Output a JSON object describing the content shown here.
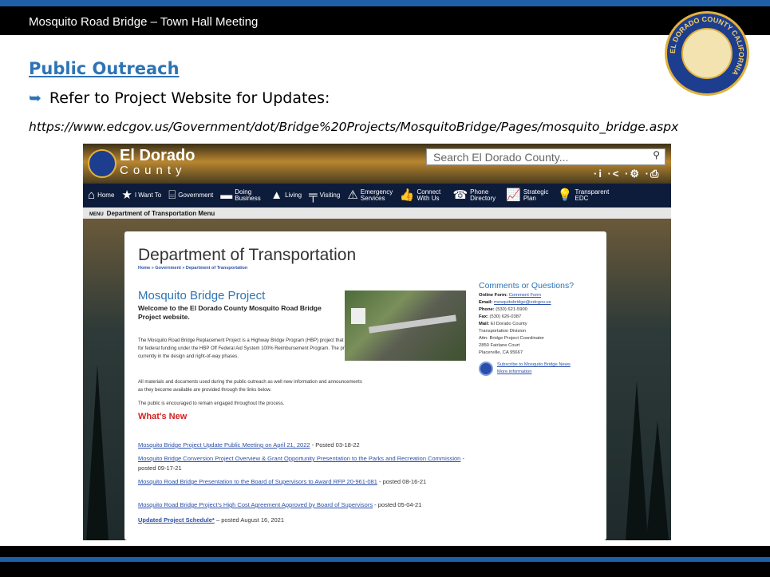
{
  "slide": {
    "header": "Mosquito Road Bridge – Town Hall Meeting",
    "section_title": "Public Outreach",
    "bullet_text": "Refer to Project Website for Updates:",
    "url": "https://www.edcgov.us/Government/dot/Bridge%20Projects/MosquitoBridge/Pages/mosquito_bridge.aspx",
    "seal_text": "EL DORADO COUNTY CALIFORNIA"
  },
  "colors": {
    "accent": "#1f5fa8",
    "title_blue": "#2e74b5",
    "nav_bg": "#0e1c3b",
    "whats_new": "#d62020"
  },
  "site": {
    "name_line1": "El Dorado",
    "name_line2": "County",
    "search_placeholder": "Search El Dorado County...",
    "tools": "·i ·< ·⚙ ·⎙",
    "nav": [
      {
        "icon": "home-icon",
        "glyph": "⌂",
        "label": "Home"
      },
      {
        "icon": "star-icon",
        "glyph": "★",
        "label": "I Want To"
      },
      {
        "icon": "government-icon",
        "glyph": "⌸",
        "label": "Government"
      },
      {
        "icon": "briefcase-icon",
        "glyph": "▬",
        "label": "Doing Business"
      },
      {
        "icon": "tree-icon",
        "glyph": "▲",
        "label": "Living"
      },
      {
        "icon": "signpost-icon",
        "glyph": "╤",
        "label": "Visiting"
      },
      {
        "icon": "warning-icon",
        "glyph": "⚠",
        "label": "Emergency Services"
      },
      {
        "icon": "thumbs-up-icon",
        "glyph": "👍",
        "label": "Connect With Us"
      },
      {
        "icon": "phone-icon",
        "glyph": "☎",
        "label": "Phone Directory"
      },
      {
        "icon": "chart-icon",
        "glyph": "📈",
        "label": "Strategic Plan"
      },
      {
        "icon": "lightbulb-icon",
        "glyph": "💡",
        "label": "Transparent EDC"
      }
    ],
    "menu_label": "Department of Transportation Menu",
    "menu_burger": "MENU",
    "dept_title": "Department of Transportation",
    "breadcrumb": "Home » Government » Department of Transportation",
    "project_title": "Mosquito Bridge Project",
    "welcome": "Welcome to the El Dorado County Mosquito Road Bridge Project website.",
    "para1": "The Mosquito Road Bridge Replacement Project is a Highway Bridge Program (HBP) project that is eligible for federal funding under the HBP Off Federal Aid System 100% Reimbursement Program. The project is currently in the design and right-of-way phases.",
    "para2": "All materials and documents used during the public outreach as well new information and announcements as they become available are provided through the links below.",
    "para3": "The public is encouraged to remain engaged throughout the process.",
    "whats_new": "What's New",
    "news": [
      {
        "link": "Mosquito Bridge Project Update Public Meeting on April 21, 2022",
        "suffix": " - Posted 03-18-22"
      },
      {
        "link": "Mosquito Bridge Conversion Project Overview & Grant Opportunity Presentation to the Parks and Recreation Commission",
        "suffix": " - posted 09-17-21"
      },
      {
        "link": "Mosquito Road Bridge Presentation to the Board of Supervisors to Award RFP 20-961-081",
        "suffix": " - posted 08-16-21"
      },
      {
        "link": "Mosquito Road Bridge Project's High Cost Agreement Approved by Board of Supervisors",
        "suffix": " - posted 05-04-21"
      },
      {
        "link": "Updated Project Schedule*",
        "suffix": " – posted August 16, 2021"
      }
    ],
    "contact": {
      "title": "Comments or Questions?",
      "online_label": "Online Form:",
      "online_link": "Comment Form",
      "email_label": "Email:",
      "email_link": "mosquitobridge@edcgov.us",
      "phone_label": "Phone:",
      "phone": "(530) 621-5900",
      "fax_label": "Fax:",
      "fax": "(530) 626-0387",
      "mail_label": "Mail:",
      "mail1": "El Dorado County",
      "mail2": "Transportation Division",
      "mail3": "Attn: Bridge Project Coordinator",
      "mail4": "2850 Fairlane Court",
      "mail5": "Placerville, CA 95667",
      "subscribe": "Subscribe to Mosquito Bridge News",
      "more_info": "More information"
    }
  }
}
